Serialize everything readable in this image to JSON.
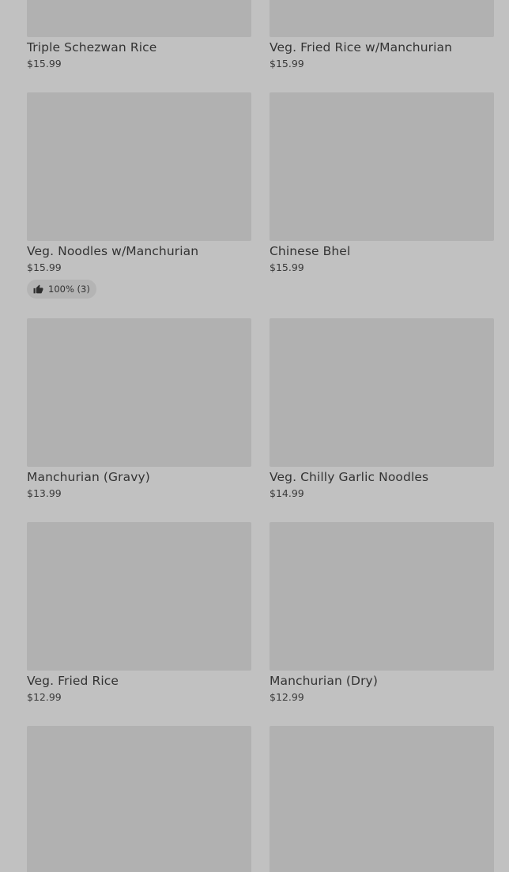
{
  "items": [
    {
      "name": "Triple Schezwan Rice",
      "price": "$15.99"
    },
    {
      "name": "Veg. Fried Rice w/Manchurian",
      "price": "$15.99"
    },
    {
      "name": "Veg. Noodles w/Manchurian",
      "price": "$15.99",
      "rating": "100% (3)",
      "rating_icon": "thumbs-up-icon"
    },
    {
      "name": "Chinese Bhel",
      "price": "$15.99"
    },
    {
      "name": "Manchurian (Gravy)",
      "price": "$13.99"
    },
    {
      "name": "Veg. Chilly Garlic Noodles",
      "price": "$14.99"
    },
    {
      "name": "Veg. Fried Rice",
      "price": "$12.99"
    },
    {
      "name": "Manchurian (Dry)",
      "price": "$12.99"
    },
    {
      "name": "",
      "price": ""
    },
    {
      "name": "",
      "price": ""
    }
  ],
  "colors": {
    "background": "#c1c1c1",
    "image_placeholder": "#b1b1b1",
    "text": "#333333",
    "badge": "#b4b4b4"
  }
}
